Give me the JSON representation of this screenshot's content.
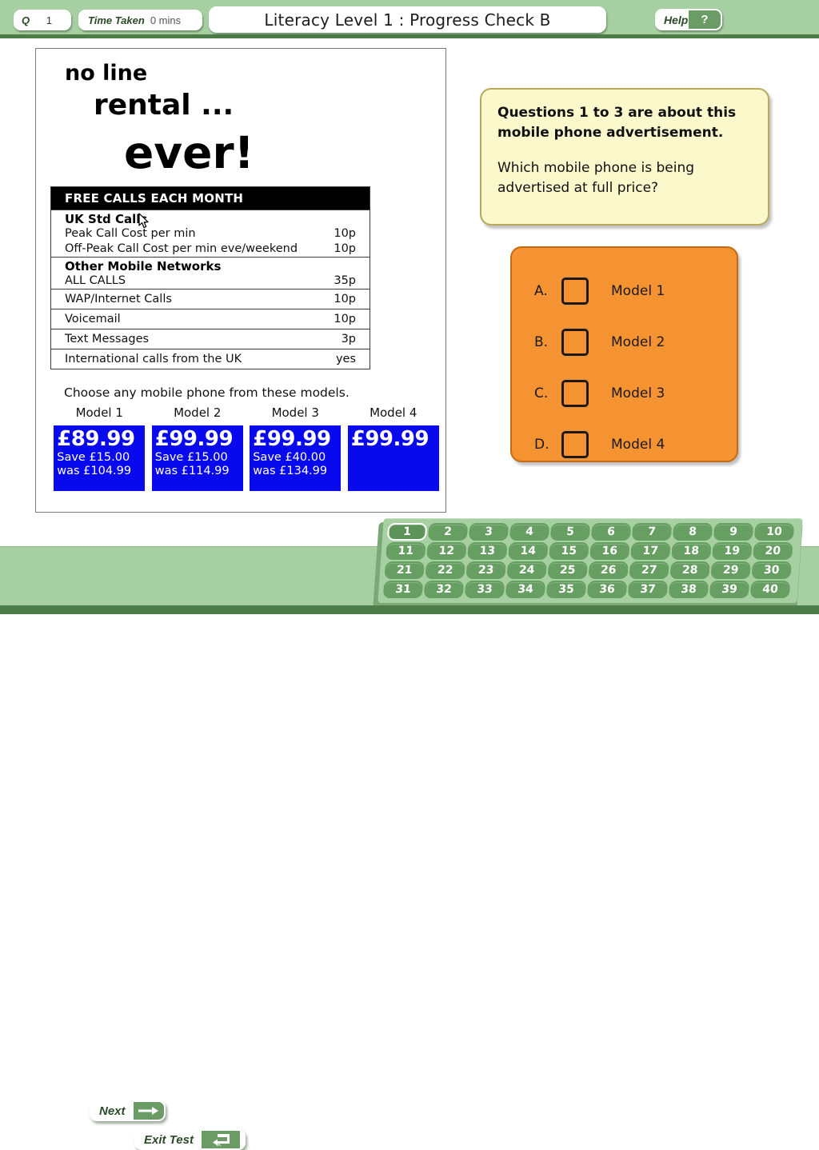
{
  "header": {
    "q_label": "Q",
    "q_number": "1",
    "time_label": "Time Taken",
    "time_value": "0 mins",
    "title": "Literacy Level 1 : Progress Check B",
    "help_label": "Help",
    "help_symbol": "?"
  },
  "advert": {
    "line1": "no line",
    "line2": "rental ...",
    "line3": "ever!",
    "table_header": "FREE CALLS EACH MONTH",
    "groups": [
      {
        "subtitle": "UK Std Calls",
        "rows": [
          {
            "label": "Peak Call Cost per min",
            "value": "10p"
          },
          {
            "label": "Off-Peak Call Cost per min eve/weekend",
            "value": "10p"
          }
        ]
      },
      {
        "subtitle": "Other Mobile Networks",
        "rows": [
          {
            "label": "ALL CALLS",
            "value": "35p"
          }
        ]
      }
    ],
    "simple_rows": [
      {
        "label": "WAP/Internet Calls",
        "value": "10p"
      },
      {
        "label": "Voicemail",
        "value": "10p"
      },
      {
        "label": "Text Messages",
        "value": "3p"
      },
      {
        "label": "International calls from the UK",
        "value": "yes"
      }
    ],
    "choose_text": "Choose any mobile phone from these models.",
    "models": [
      {
        "name": "Model 1",
        "price": "£89.99",
        "save": "Save £15.00",
        "was": "was £104.99"
      },
      {
        "name": "Model 2",
        "price": "£99.99",
        "save": "Save £15.00",
        "was": "was £114.99"
      },
      {
        "name": "Model 3",
        "price": "£99.99",
        "save": "Save £40.00",
        "was": "was £134.99"
      },
      {
        "name": "Model 4",
        "price": "£99.99",
        "save": "",
        "was": ""
      }
    ]
  },
  "question": {
    "intro": "Questions 1 to 3 are about this mobile phone advertisement.",
    "prompt": "Which mobile phone is being advertised at full price?"
  },
  "answers": [
    {
      "letter": "A.",
      "label": "Model 1"
    },
    {
      "letter": "B.",
      "label": "Model 2"
    },
    {
      "letter": "C.",
      "label": "Model 3"
    },
    {
      "letter": "D.",
      "label": "Model 4"
    }
  ],
  "footer": {
    "next_label": "Next",
    "exit_label": "Exit Test",
    "numbers": [
      [
        "1",
        "2",
        "3",
        "4",
        "5",
        "6",
        "7",
        "8",
        "9",
        "10"
      ],
      [
        "11",
        "12",
        "13",
        "14",
        "15",
        "16",
        "17",
        "18",
        "19",
        "20"
      ],
      [
        "21",
        "22",
        "23",
        "24",
        "25",
        "26",
        "27",
        "28",
        "29",
        "30"
      ],
      [
        "31",
        "32",
        "33",
        "34",
        "35",
        "36",
        "37",
        "38",
        "39",
        "40"
      ]
    ],
    "current_number": "1"
  },
  "colors": {
    "header_green": "#a6cfa2",
    "dark_green": "#4c7d49",
    "button_green": "#6b9c66",
    "question_yellow": "#fbf8cc",
    "answer_orange": "#f59332",
    "price_blue": "#0909ee"
  }
}
